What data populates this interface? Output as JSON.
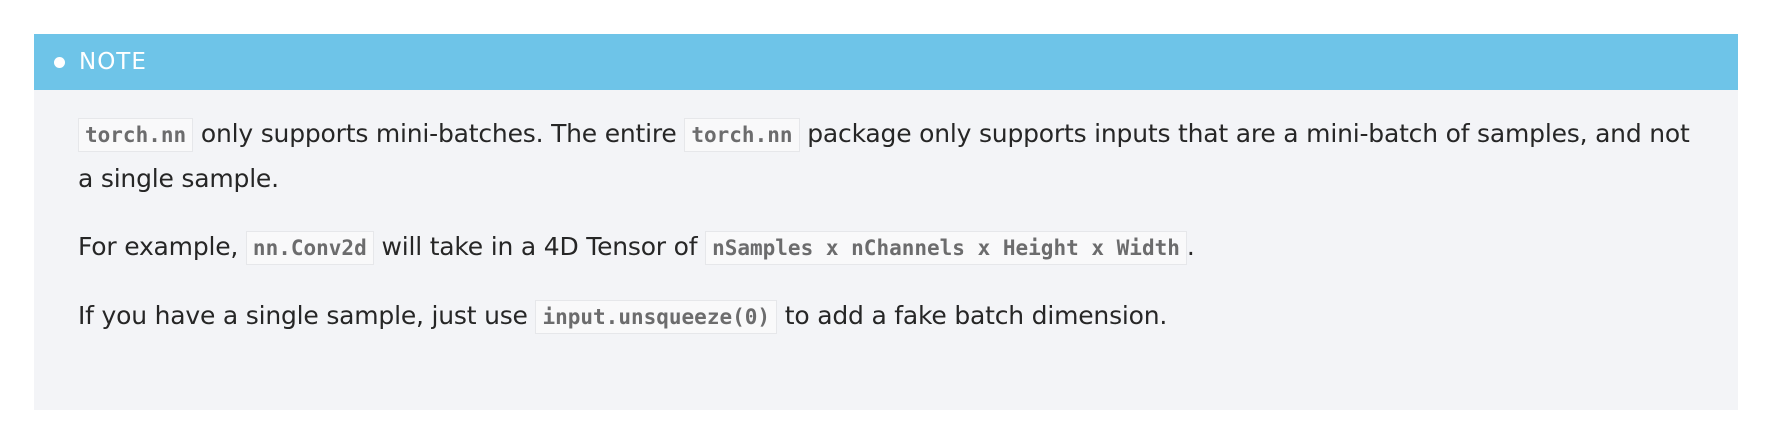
{
  "note": {
    "title": "NOTE",
    "paragraphs": [
      {
        "code1": "torch.nn",
        "text1": " only supports mini-batches. The entire ",
        "code2": "torch.nn",
        "text2": " package only supports inputs that are a mini-batch of samples, and not a single sample."
      },
      {
        "text1": "For example, ",
        "code1": "nn.Conv2d",
        "text2": " will take in a 4D Tensor of ",
        "code2": "nSamples x nChannels x Height x Width",
        "text3": "."
      },
      {
        "text1": "If you have a single sample, just use ",
        "code1": "input.unsqueeze(0)",
        "text2": " to add a fake batch dimension."
      }
    ]
  },
  "colors": {
    "header": "#6ec4e8",
    "body_background": "#f3f4f7",
    "code_text": "#6c6c6d"
  }
}
